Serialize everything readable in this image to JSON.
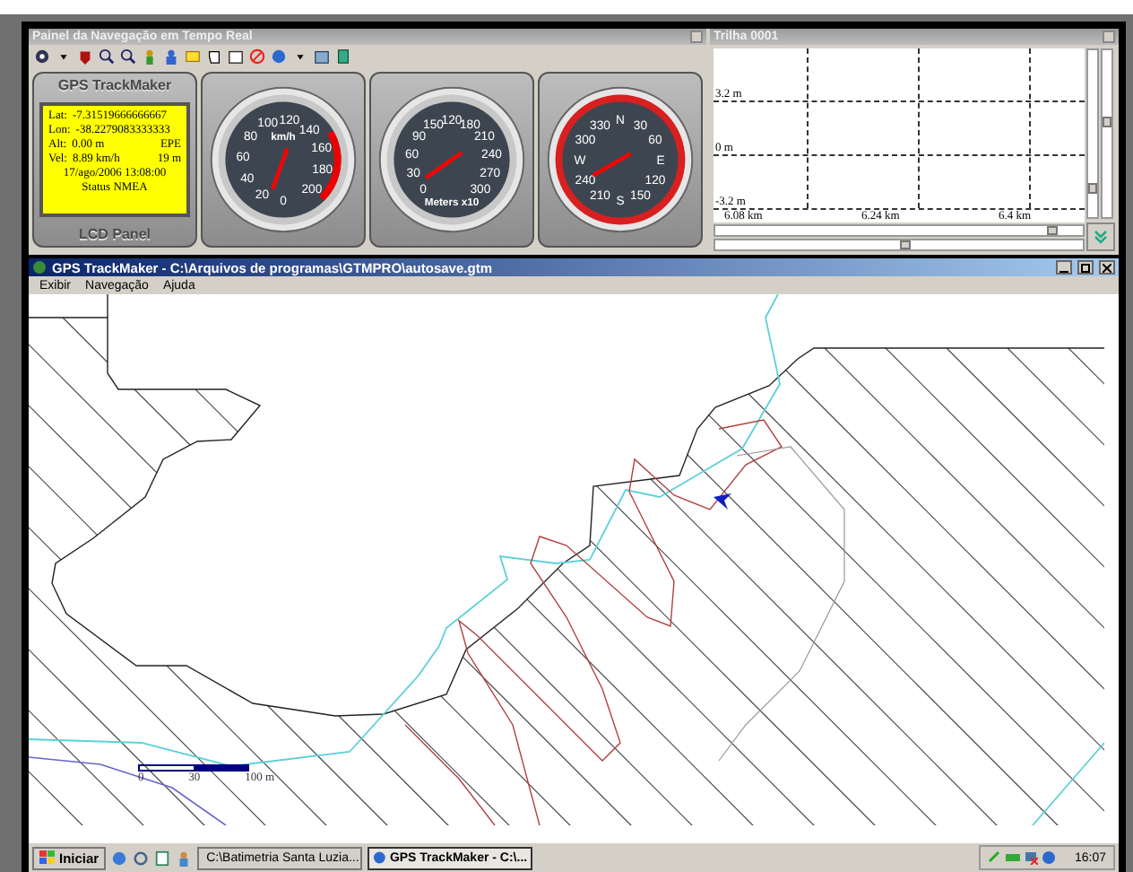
{
  "nav_panel": {
    "title": "Painel da Navegação em Tempo Real",
    "lcd": {
      "header": "GPS TrackMaker",
      "footer": "LCD Panel",
      "rows": [
        {
          "label": "Lat:",
          "value": "-7.31519666666667",
          "extra": ""
        },
        {
          "label": "Lon:",
          "value": "-38.2279083333333",
          "extra": ""
        },
        {
          "label": "Alt:",
          "value": "0.00 m",
          "extra": "EPE"
        },
        {
          "label": "Vel:",
          "value": "8.89 km/h",
          "extra": "19 m"
        }
      ],
      "timestamp": "17/ago/2006 13:08:00",
      "status": "Status NMEA"
    },
    "gauges": [
      {
        "kind": "speed",
        "unit": "km/h",
        "labels": [
          "100",
          "120",
          "140",
          "80",
          "160",
          "60",
          "180",
          "40",
          "200",
          "20",
          "0"
        ]
      },
      {
        "kind": "altitude",
        "unit": "Meters x10",
        "labels": [
          "150",
          "120",
          "180",
          "90",
          "210",
          "60",
          "240",
          "30",
          "270",
          "0",
          "300"
        ]
      },
      {
        "kind": "compass",
        "labels": [
          "N",
          "330",
          "30",
          "300",
          "60",
          "W",
          "E",
          "240",
          "120",
          "210",
          "150",
          "S"
        ]
      }
    ]
  },
  "track_panel": {
    "title": "Trilha 0001",
    "y_labels": [
      "3.2 m",
      "0 m",
      "-3.2 m"
    ],
    "x_labels": [
      "6.08 km",
      "6.24 km",
      "6.4 km"
    ]
  },
  "main_window": {
    "title": "GPS TrackMaker - C:\\Arquivos de programas\\GTMPRO\\autosave.gtm",
    "menu": [
      "Exibir",
      "Navegação",
      "Ajuda"
    ],
    "scale_labels": [
      "0",
      "30",
      "100 m"
    ]
  },
  "taskbar": {
    "start": "Iniciar",
    "tasks": [
      {
        "label": "C:\\Batimetria Santa Luzia...",
        "selected": false
      },
      {
        "label": "GPS TrackMaker - C:\\...",
        "selected": true
      }
    ],
    "clock": "16:07"
  }
}
